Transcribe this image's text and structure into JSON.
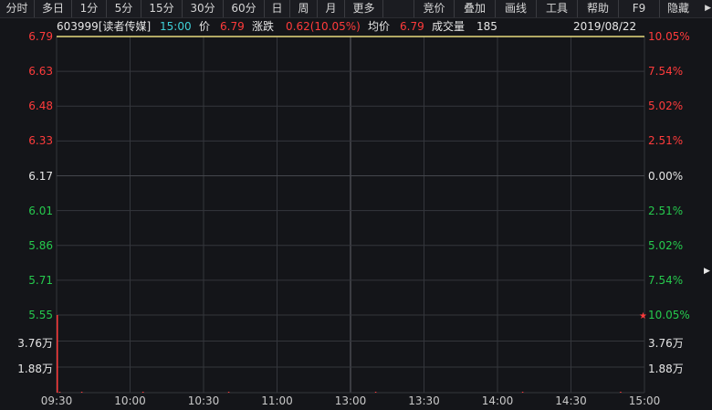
{
  "toolbar": {
    "items": [
      "分时",
      "多日",
      "1分",
      "5分",
      "15分",
      "30分",
      "60分",
      "日",
      "周",
      "月",
      "更多",
      "竞价",
      "叠加",
      "画线",
      "工具",
      "帮助",
      "F9",
      "隐藏"
    ]
  },
  "info": {
    "code_name": "603999[读者传媒]",
    "time": "15:00",
    "price_label": "价",
    "price": "6.79",
    "change_label": "涨跌",
    "change": "0.62(10.05%)",
    "avg_label": "均价",
    "avg": "6.79",
    "volume_label": "成交量",
    "volume": "185",
    "date": "2019/08/22"
  },
  "colors": {
    "up": "#ff3b3b",
    "down": "#26c94d",
    "flat": "#e6e6e6",
    "grid": "#34363c",
    "time_accent": "#3fd0d8"
  },
  "chart_data": {
    "type": "line",
    "title": "603999[读者传媒]",
    "x_ticks": [
      "09:30",
      "10:00",
      "10:30",
      "11:00",
      "13:00",
      "13:30",
      "14:00",
      "14:30",
      "15:00"
    ],
    "price_ticks": [
      {
        "price": "6.79",
        "pct": "10.05%",
        "dir": "up"
      },
      {
        "price": "6.63",
        "pct": "7.54%",
        "dir": "up"
      },
      {
        "price": "6.48",
        "pct": "5.02%",
        "dir": "up"
      },
      {
        "price": "6.33",
        "pct": "2.51%",
        "dir": "up"
      },
      {
        "price": "6.17",
        "pct": "0.00%",
        "dir": "flat"
      },
      {
        "price": "6.01",
        "pct": "2.51%",
        "dir": "down"
      },
      {
        "price": "5.86",
        "pct": "5.02%",
        "dir": "down"
      },
      {
        "price": "5.71",
        "pct": "7.54%",
        "dir": "down"
      },
      {
        "price": "5.55",
        "pct": "10.05%",
        "dir": "down"
      }
    ],
    "prev_close": 6.17,
    "price_range": [
      5.55,
      6.79
    ],
    "price_series": [
      {
        "time": "09:30",
        "price": 6.79
      },
      {
        "time": "15:00",
        "price": 6.79
      }
    ],
    "avg_series": [
      {
        "time": "09:30",
        "price": 6.79
      },
      {
        "time": "15:00",
        "price": 6.79
      }
    ],
    "volume_ticks": [
      "3.76万",
      "1.88万"
    ],
    "volume_max": 56400,
    "volume_bars": [
      {
        "time": "09:30",
        "value": 56400
      },
      {
        "time": "09:31",
        "value": 120
      },
      {
        "time": "09:40",
        "value": 90
      },
      {
        "time": "10:05",
        "value": 110
      },
      {
        "time": "10:40",
        "value": 80
      },
      {
        "time": "13:10",
        "value": 100
      },
      {
        "time": "14:10",
        "value": 90
      },
      {
        "time": "14:50",
        "value": 110
      }
    ],
    "marker": "★"
  }
}
